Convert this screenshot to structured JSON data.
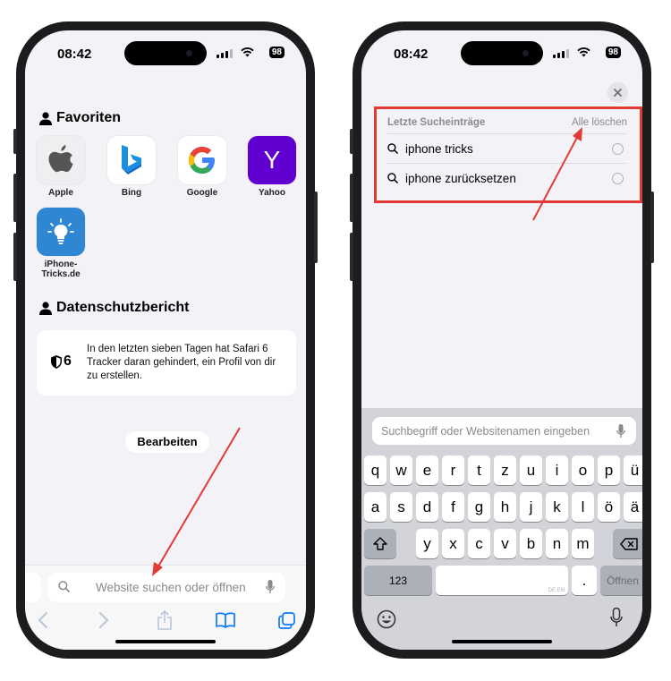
{
  "left_phone": {
    "status": {
      "time": "08:42",
      "battery": "98"
    },
    "favorites": {
      "title": "Favoriten",
      "items": [
        {
          "label": "Apple",
          "icon": "apple-logo-icon"
        },
        {
          "label": "Bing",
          "icon": "bing-logo-icon"
        },
        {
          "label": "Google",
          "icon": "google-logo-icon"
        },
        {
          "label": "Yahoo",
          "icon": "yahoo-logo-icon"
        },
        {
          "label": "iPhone-\nTricks.de",
          "icon": "lightbulb-icon"
        }
      ]
    },
    "privacy": {
      "title": "Datenschutzbericht",
      "count": "6",
      "text": "In den letzten sieben Tagen hat Safari 6 Tracker daran gehindert, ein Profil von dir zu erstellen."
    },
    "edit_button": "Bearbeiten",
    "address_bar": {
      "placeholder": "Website suchen oder öffnen"
    },
    "toolbar": [
      "back-icon",
      "forward-icon",
      "share-icon",
      "bookmarks-icon",
      "tabs-icon"
    ]
  },
  "right_phone": {
    "status": {
      "time": "08:42",
      "battery": "98"
    },
    "recent_searches": {
      "title": "Letzte Sucheinträge",
      "clear_label": "Alle löschen",
      "items": [
        "iphone tricks",
        "iphone zurücksetzen"
      ]
    },
    "search_field": {
      "placeholder": "Suchbegriff oder Websitenamen eingeben"
    },
    "keyboard": {
      "row1": [
        "q",
        "w",
        "e",
        "r",
        "t",
        "z",
        "u",
        "i",
        "o",
        "p",
        "ü"
      ],
      "row2": [
        "a",
        "s",
        "d",
        "f",
        "g",
        "h",
        "j",
        "k",
        "l",
        "ö",
        "ä"
      ],
      "row3": [
        "y",
        "x",
        "c",
        "v",
        "b",
        "n",
        "m"
      ],
      "numbers_key": "123",
      "space_lang": "DE EN",
      "period_key": ".",
      "open_key": "Öffnen"
    }
  },
  "colors": {
    "annotation": "#e23b35",
    "accent": "#0a7aff"
  }
}
